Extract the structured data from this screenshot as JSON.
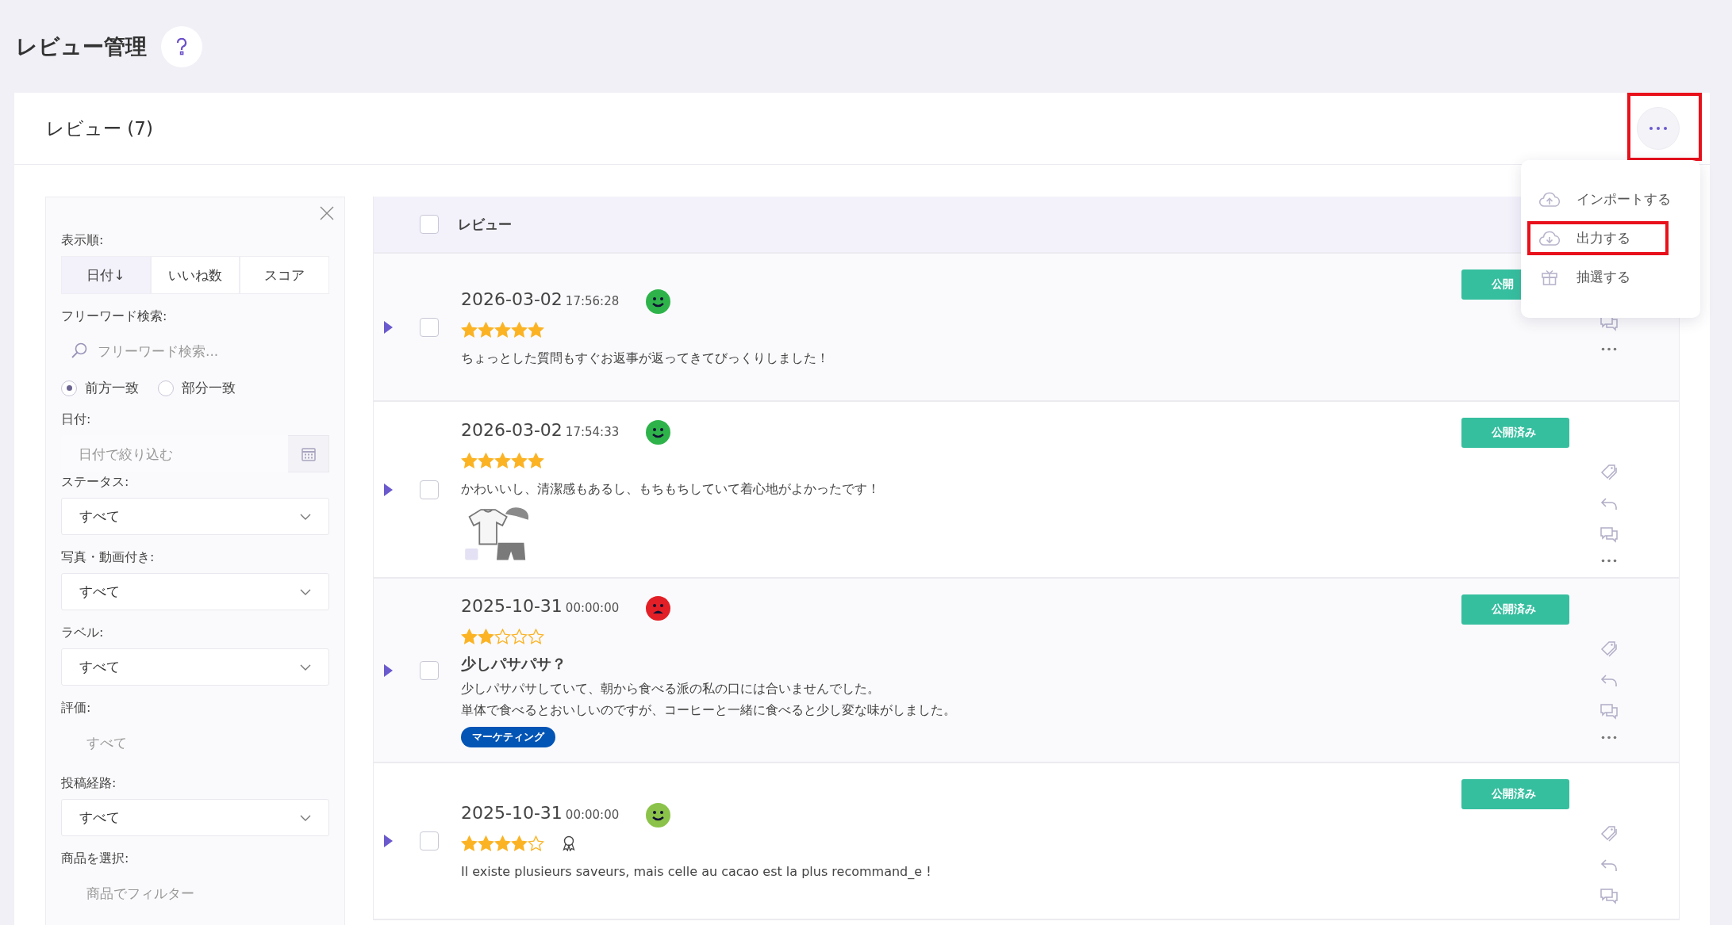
{
  "page_title": "レビュー管理",
  "card": {
    "title": "レビュー (7)",
    "more_button": {
      "highlighted": true
    }
  },
  "menu": [
    {
      "kind": "upload",
      "label": "インポートする",
      "highlighted": false
    },
    {
      "kind": "download",
      "label": "出力する",
      "highlighted": true
    },
    {
      "kind": "gift",
      "label": "抽選する",
      "highlighted": false
    }
  ],
  "filters": {
    "sort_label": "表示順:",
    "sort_options": [
      {
        "label": "日付↓",
        "selected": true
      },
      {
        "label": "いいね数",
        "selected": false
      },
      {
        "label": "スコア",
        "selected": false
      }
    ],
    "search_label": "フリーワード検索:",
    "search_placeholder": "フリーワード検索...",
    "match_modes": [
      {
        "label": "前方一致",
        "selected": true
      },
      {
        "label": "部分一致",
        "selected": false
      }
    ],
    "date_label": "日付:",
    "date_placeholder": "日付で絞り込む",
    "fields": [
      {
        "kind": "select",
        "label": "ステータス:",
        "value": "すべて"
      },
      {
        "kind": "select",
        "label": "写真・動画付き:",
        "value": "すべて"
      },
      {
        "kind": "select",
        "label": "ラベル:",
        "value": "すべて"
      },
      {
        "kind": "input",
        "label": "評価:",
        "placeholder": "すべて"
      },
      {
        "kind": "select",
        "label": "投稿経路:",
        "value": "すべて"
      },
      {
        "kind": "input",
        "label": "商品を選択:",
        "placeholder": "商品でフィルター"
      }
    ]
  },
  "table": {
    "header": "レビュー",
    "checked": false,
    "rows": [
      {
        "checked": false,
        "date": "2026-03-02",
        "time": "17:56:28",
        "face": {
          "kind": "happy",
          "color": "#2eb34a"
        },
        "stars": 5,
        "award": false,
        "lines": [
          "ちょっとした質問もすぐお返事が返ってきてびっくりしました！"
        ],
        "image": false,
        "tags": [],
        "status": "公開",
        "actions": [
          {
            "kind": "chat"
          },
          {
            "kind": "more"
          }
        ]
      },
      {
        "checked": false,
        "date": "2026-03-02",
        "time": "17:54:33",
        "face": {
          "kind": "happy",
          "color": "#2eb34a"
        },
        "stars": 5,
        "award": false,
        "lines": [
          "かわいいし、清潔感もあるし、もちもちしていて着心地がよかったです！"
        ],
        "image": true,
        "tags": [],
        "status": "公開済み",
        "actions": [
          {
            "kind": "tag"
          },
          {
            "kind": "reply"
          },
          {
            "kind": "chat"
          },
          {
            "kind": "more"
          }
        ]
      },
      {
        "checked": false,
        "date": "2025-10-31",
        "time": "00:00:00",
        "face": {
          "kind": "sad",
          "color": "#e21f26"
        },
        "stars": 2,
        "award": false,
        "title": "少しパサパサ？",
        "lines": [
          "少しパサパサしていて、朝から食べる派の私の口には合いませんでした。",
          "単体で食べるとおいしいのですが、コーヒーと一緒に食べると少し変な味がしました。"
        ],
        "image": false,
        "tags": [
          "マーケティング"
        ],
        "status": "公開済み",
        "actions": [
          {
            "kind": "tag"
          },
          {
            "kind": "reply"
          },
          {
            "kind": "chat"
          },
          {
            "kind": "more"
          }
        ]
      },
      {
        "checked": false,
        "date": "2025-10-31",
        "time": "00:00:00",
        "face": {
          "kind": "happy",
          "color": "#8bc34a"
        },
        "stars": 4,
        "award": true,
        "lines": [
          "Il existe plusieurs saveurs, mais celle au cacao est la plus recommand_e !"
        ],
        "image": false,
        "tags": [],
        "status": "公開済み",
        "actions": [
          {
            "kind": "tag"
          },
          {
            "kind": "reply"
          },
          {
            "kind": "chat"
          }
        ]
      }
    ]
  }
}
